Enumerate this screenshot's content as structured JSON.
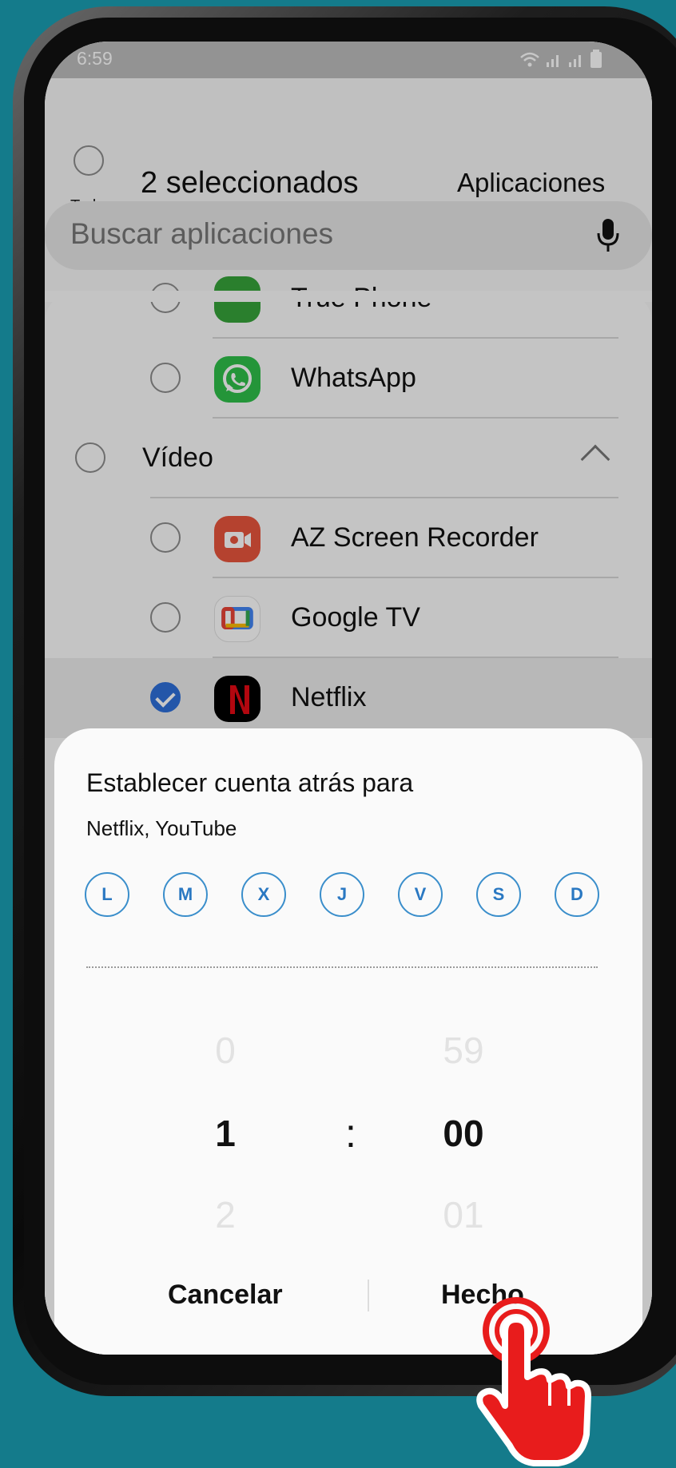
{
  "status_bar": {
    "time": "6:59"
  },
  "header": {
    "select_all_label": "Todo",
    "title": "2 seleccionados",
    "right_label": "Aplicaciones"
  },
  "search": {
    "placeholder": "Buscar aplicaciones"
  },
  "list": {
    "partial_item": "True Phone",
    "items": [
      {
        "label": "WhatsApp",
        "icon": "whatsapp-icon",
        "selected": false
      },
      {
        "label": "Vídeo",
        "section": true
      },
      {
        "label": "AZ Screen Recorder",
        "icon": "screen-recorder-icon",
        "selected": false
      },
      {
        "label": "Google TV",
        "icon": "google-tv-icon",
        "selected": false
      },
      {
        "label": "Netflix",
        "icon": "netflix-icon",
        "selected": true
      }
    ]
  },
  "sheet": {
    "title": "Establecer cuenta atrás para",
    "apps": "Netflix, YouTube",
    "days": [
      "L",
      "M",
      "X",
      "J",
      "V",
      "S",
      "D"
    ],
    "hours": {
      "prev": "0",
      "current": "1",
      "next": "2"
    },
    "minutes": {
      "prev": "59",
      "current": "00",
      "next": "01"
    },
    "separator": ":",
    "cancel_label": "Cancelar",
    "done_label": "Hecho"
  },
  "colors": {
    "background": "#147b8b",
    "accent": "#2e6fd9",
    "day_outline": "#3a8ecb",
    "hand": "#e81c1c"
  }
}
